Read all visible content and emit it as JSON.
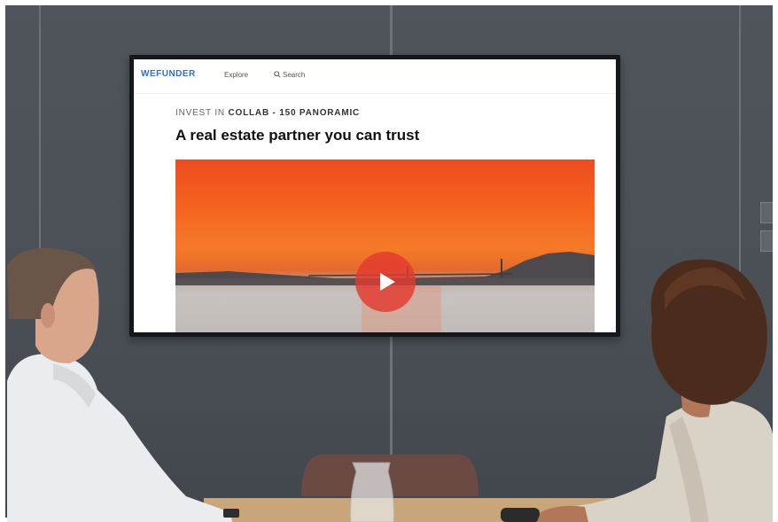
{
  "screen": {
    "brand": "WEFUNDER",
    "nav": {
      "explore": "Explore",
      "search": "Search"
    },
    "eyebrow_prefix": "INVEST IN",
    "eyebrow_strong": "COLLAB - 150 PANORAMIC",
    "headline": "A real estate partner you can trust",
    "video": {
      "play_icon": "play-icon",
      "brand_color": "#2f6fd1",
      "play_color": "#e23a30"
    }
  }
}
